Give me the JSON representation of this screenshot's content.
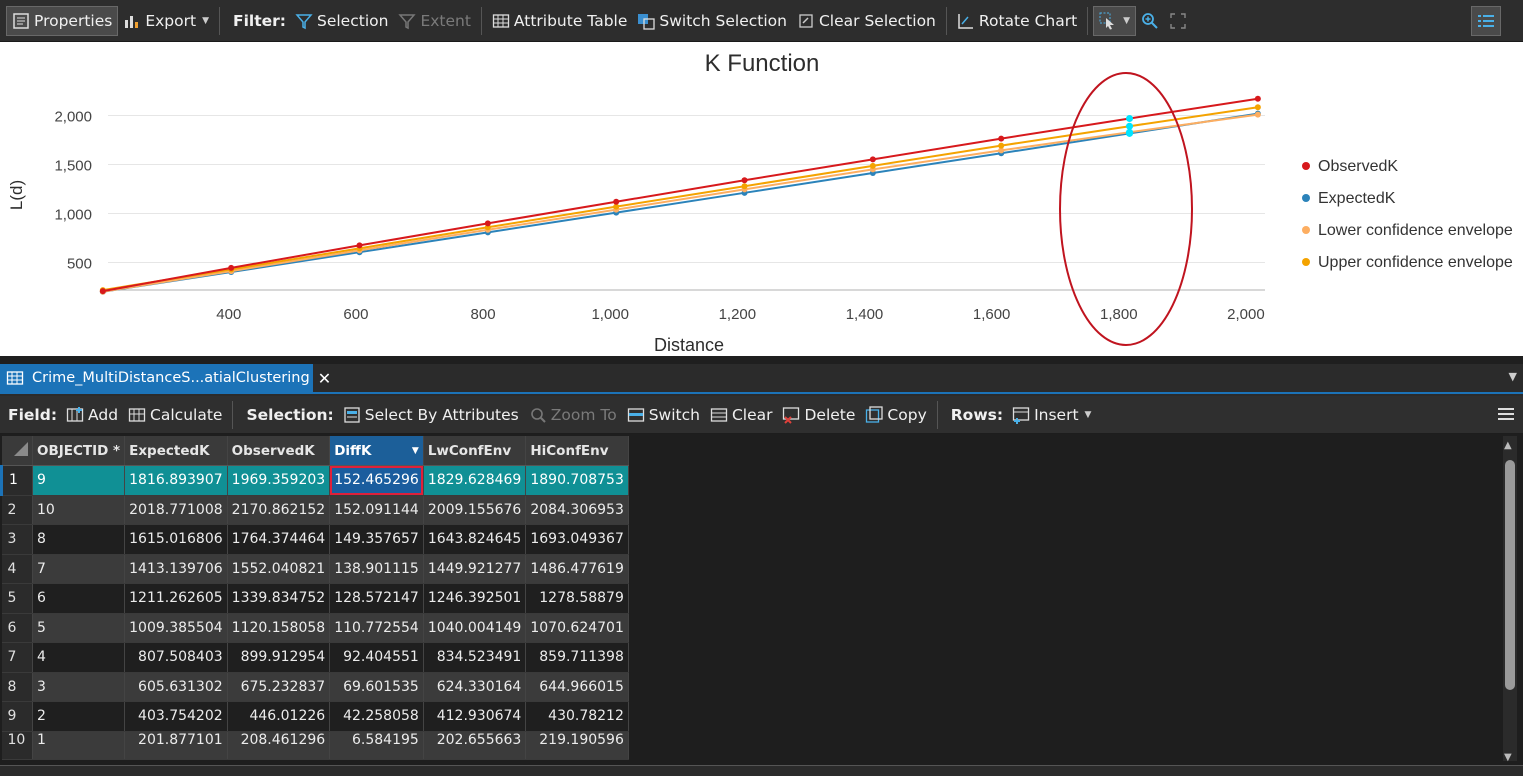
{
  "chart_toolbar": {
    "properties": "Properties",
    "export": "Export",
    "filter_label": "Filter:",
    "selection": "Selection",
    "extent": "Extent",
    "attribute_table": "Attribute Table",
    "switch_selection": "Switch Selection",
    "clear_selection": "Clear Selection",
    "rotate_chart": "Rotate Chart"
  },
  "chart_data": {
    "type": "line",
    "title": "K Function",
    "xlabel": "Distance",
    "ylabel": "L(d)",
    "xlim": [
      210,
      2030
    ],
    "ylim": [
      220,
      2260
    ],
    "x_ticks": [
      400,
      600,
      800,
      1000,
      1200,
      1400,
      1600,
      1800,
      2000
    ],
    "x_tick_labels": [
      "400",
      "600",
      "800",
      "1,000",
      "1,200",
      "1,400",
      "1,600",
      "1,800",
      "2,000"
    ],
    "y_ticks": [
      500,
      1000,
      1500,
      2000
    ],
    "y_tick_labels": [
      "500",
      "1,000",
      "1,500",
      "2,000"
    ],
    "grid": "horizontal",
    "legend_position": "right",
    "x": [
      201.877101,
      403.754202,
      605.631302,
      807.508403,
      1009.385504,
      1211.262605,
      1413.139706,
      1615.016806,
      1816.893907,
      2018.771008
    ],
    "series": [
      {
        "name": "ObservedK",
        "color": "#d7191c",
        "values": [
          208.461296,
          446.01226,
          675.232837,
          899.912954,
          1120.158058,
          1339.834752,
          1552.040821,
          1764.374464,
          1969.359203,
          2170.862152
        ]
      },
      {
        "name": "ExpectedK",
        "color": "#2b83ba",
        "values": [
          201.877101,
          403.754202,
          605.631302,
          807.508403,
          1009.385504,
          1211.262605,
          1413.139706,
          1615.016806,
          1816.893907,
          2018.771008
        ]
      },
      {
        "name": "Lower confidence envelope",
        "color": "#fdae61",
        "values": [
          202.655663,
          412.930674,
          624.330164,
          834.523491,
          1040.004149,
          1246.392501,
          1449.921277,
          1643.824645,
          1829.628469,
          2009.155676
        ]
      },
      {
        "name": "Upper confidence envelope",
        "color": "#f4a300",
        "values": [
          219.190596,
          430.78212,
          644.966015,
          859.711398,
          1070.624701,
          1278.58879,
          1486.477619,
          1693.049367,
          1890.708753,
          2084.306953
        ]
      }
    ],
    "selected_x": 1816.893907,
    "annotation": "red ellipse around distance 1800",
    "highlight_color": "#00e5ff",
    "annotation_color": "#c0141f"
  },
  "table_tab": {
    "title": "Crime_MultiDistanceS...atialClustering"
  },
  "table_toolbar": {
    "field_label": "Field:",
    "add": "Add",
    "calculate": "Calculate",
    "selection_label": "Selection:",
    "select_by_attributes": "Select By Attributes",
    "zoom_to": "Zoom To",
    "switch": "Switch",
    "clear": "Clear",
    "delete": "Delete",
    "copy": "Copy",
    "rows_label": "Rows:",
    "insert": "Insert"
  },
  "table": {
    "columns": [
      "OBJECTID *",
      "ExpectedK",
      "ObservedK",
      "DiffK",
      "LwConfEnv",
      "HiConfEnv"
    ],
    "sorted_column": "DiffK",
    "rows": [
      {
        "n": "1",
        "oid": "9",
        "ExpectedK": "1816.893907",
        "ObservedK": "1969.359203",
        "DiffK": "152.465296",
        "LwConfEnv": "1829.628469",
        "HiConfEnv": "1890.708753"
      },
      {
        "n": "2",
        "oid": "10",
        "ExpectedK": "2018.771008",
        "ObservedK": "2170.862152",
        "DiffK": "152.091144",
        "LwConfEnv": "2009.155676",
        "HiConfEnv": "2084.306953"
      },
      {
        "n": "3",
        "oid": "8",
        "ExpectedK": "1615.016806",
        "ObservedK": "1764.374464",
        "DiffK": "149.357657",
        "LwConfEnv": "1643.824645",
        "HiConfEnv": "1693.049367"
      },
      {
        "n": "4",
        "oid": "7",
        "ExpectedK": "1413.139706",
        "ObservedK": "1552.040821",
        "DiffK": "138.901115",
        "LwConfEnv": "1449.921277",
        "HiConfEnv": "1486.477619"
      },
      {
        "n": "5",
        "oid": "6",
        "ExpectedK": "1211.262605",
        "ObservedK": "1339.834752",
        "DiffK": "128.572147",
        "LwConfEnv": "1246.392501",
        "HiConfEnv": "1278.58879"
      },
      {
        "n": "6",
        "oid": "5",
        "ExpectedK": "1009.385504",
        "ObservedK": "1120.158058",
        "DiffK": "110.772554",
        "LwConfEnv": "1040.004149",
        "HiConfEnv": "1070.624701"
      },
      {
        "n": "7",
        "oid": "4",
        "ExpectedK": "807.508403",
        "ObservedK": "899.912954",
        "DiffK": "92.404551",
        "LwConfEnv": "834.523491",
        "HiConfEnv": "859.711398"
      },
      {
        "n": "8",
        "oid": "3",
        "ExpectedK": "605.631302",
        "ObservedK": "675.232837",
        "DiffK": "69.601535",
        "LwConfEnv": "624.330164",
        "HiConfEnv": "644.966015"
      },
      {
        "n": "9",
        "oid": "2",
        "ExpectedK": "403.754202",
        "ObservedK": "446.01226",
        "DiffK": "42.258058",
        "LwConfEnv": "412.930674",
        "HiConfEnv": "430.78212"
      },
      {
        "n": "10",
        "oid": "1",
        "ExpectedK": "201.877101",
        "ObservedK": "208.461296",
        "DiffK": "6.584195",
        "LwConfEnv": "202.655663",
        "HiConfEnv": "219.190596"
      }
    ],
    "selected_row": 0,
    "active_cell_column": "DiffK"
  }
}
